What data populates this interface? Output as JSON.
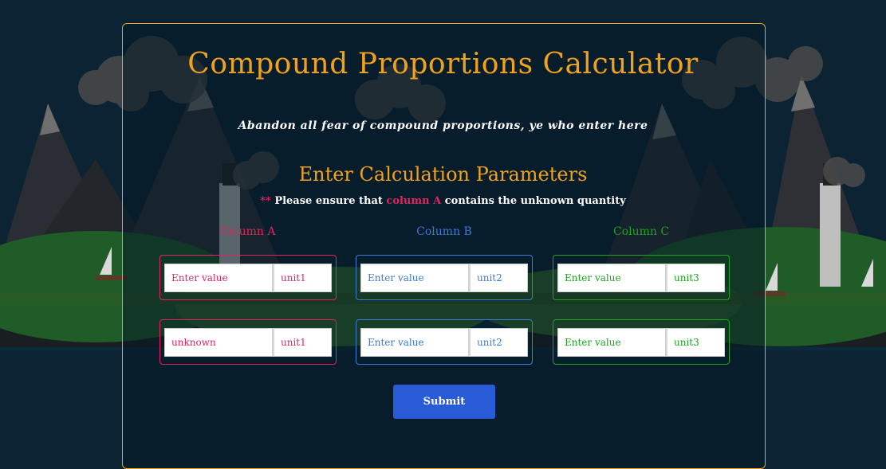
{
  "header": {
    "title": "Compound Proportions Calculator",
    "subtitle": "Abandon all fear of compound proportions, ye who enter here"
  },
  "form": {
    "section_title": "Enter Calculation Parameters",
    "note": {
      "stars": "**",
      "before": " Please ensure that ",
      "highlight": "column A",
      "after": " contains the unknown quantity"
    },
    "columns": [
      {
        "label": "Column A",
        "rows": [
          {
            "value": "",
            "value_placeholder": "Enter value",
            "unit": "",
            "unit_placeholder": "unit1"
          },
          {
            "value": "",
            "value_placeholder": "unknown",
            "unit": "",
            "unit_placeholder": "unit1"
          }
        ]
      },
      {
        "label": "Column B",
        "rows": [
          {
            "value": "",
            "value_placeholder": "Enter value",
            "unit": "",
            "unit_placeholder": "unit2"
          },
          {
            "value": "",
            "value_placeholder": "Enter value",
            "unit": "",
            "unit_placeholder": "unit2"
          }
        ]
      },
      {
        "label": "Column C",
        "rows": [
          {
            "value": "",
            "value_placeholder": "Enter value",
            "unit": "",
            "unit_placeholder": "unit3"
          },
          {
            "value": "",
            "value_placeholder": "Enter value",
            "unit": "",
            "unit_placeholder": "unit3"
          }
        ]
      }
    ],
    "submit_label": "Submit"
  },
  "colors": {
    "background": "#0b2333",
    "accent": "#f0a21b",
    "column_a": "#e0245e",
    "column_b": "#3b7ad6",
    "column_c": "#22a122",
    "submit": "#2a5bd7"
  }
}
